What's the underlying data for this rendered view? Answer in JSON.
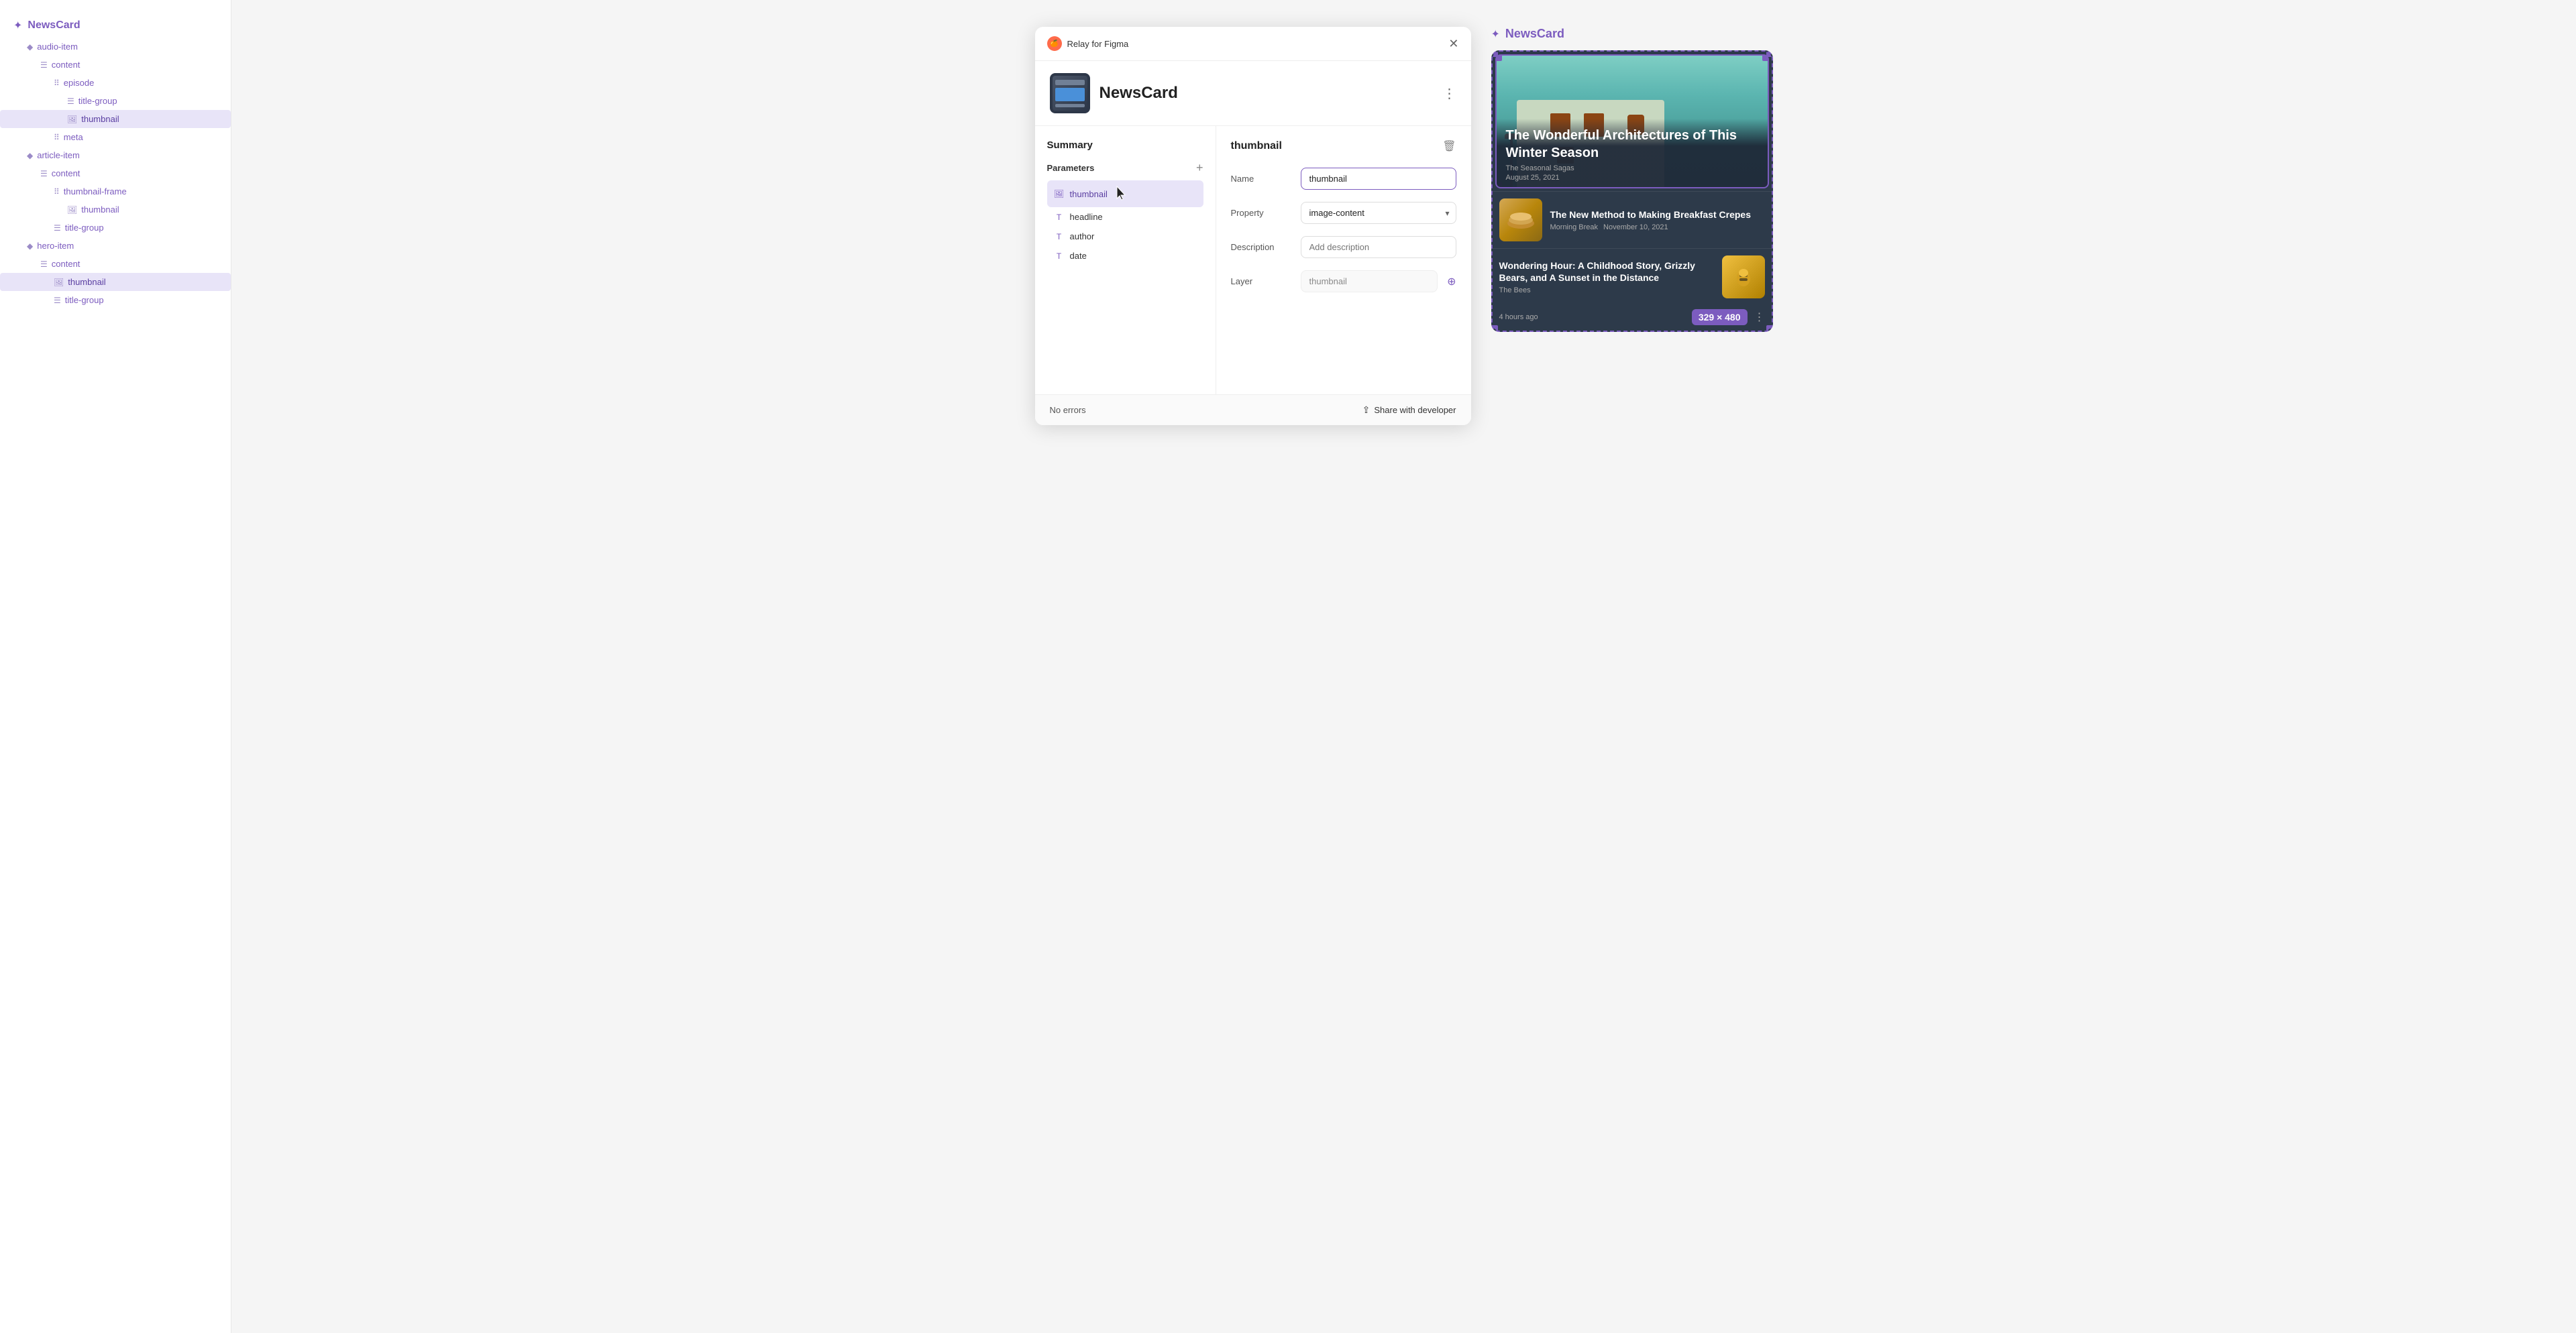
{
  "app": {
    "title": "NewsCard"
  },
  "sidebar": {
    "root_label": "NewsCard",
    "items": [
      {
        "id": "audio-item",
        "label": "audio-item",
        "icon": "diamond",
        "indent": 1,
        "selected": false
      },
      {
        "id": "content",
        "label": "content",
        "icon": "menu",
        "indent": 2,
        "selected": false
      },
      {
        "id": "episode",
        "label": "episode",
        "icon": "bars",
        "indent": 3,
        "selected": false
      },
      {
        "id": "title-group",
        "label": "title-group",
        "icon": "menu",
        "indent": 4,
        "selected": false
      },
      {
        "id": "thumbnail-1",
        "label": "thumbnail",
        "icon": "image",
        "indent": 4,
        "selected": true
      },
      {
        "id": "meta",
        "label": "meta",
        "icon": "bars",
        "indent": 3,
        "selected": false
      },
      {
        "id": "article-item",
        "label": "article-item",
        "icon": "diamond",
        "indent": 1,
        "selected": false
      },
      {
        "id": "content-2",
        "label": "content",
        "icon": "menu",
        "indent": 2,
        "selected": false
      },
      {
        "id": "thumbnail-frame",
        "label": "thumbnail-frame",
        "icon": "bars",
        "indent": 3,
        "selected": false
      },
      {
        "id": "thumbnail-2",
        "label": "thumbnail",
        "icon": "image",
        "indent": 4,
        "selected": false
      },
      {
        "id": "title-group-2",
        "label": "title-group",
        "icon": "menu",
        "indent": 3,
        "selected": false
      },
      {
        "id": "hero-item",
        "label": "hero-item",
        "icon": "diamond",
        "indent": 1,
        "selected": false
      },
      {
        "id": "content-3",
        "label": "content",
        "icon": "menu",
        "indent": 2,
        "selected": false
      },
      {
        "id": "thumbnail-3",
        "label": "thumbnail",
        "icon": "image",
        "indent": 3,
        "selected": true
      },
      {
        "id": "title-group-3",
        "label": "title-group",
        "icon": "menu",
        "indent": 3,
        "selected": false
      }
    ]
  },
  "dialog": {
    "title": "Relay for Figma",
    "component_name": "NewsCard",
    "sections": {
      "summary_label": "Summary",
      "parameters_label": "Parameters",
      "add_button": "+",
      "params": [
        {
          "id": "thumbnail",
          "label": "thumbnail",
          "icon": "image",
          "selected": true
        },
        {
          "id": "headline",
          "label": "headline",
          "icon": "text"
        },
        {
          "id": "author",
          "label": "author",
          "icon": "text"
        },
        {
          "id": "date",
          "label": "date",
          "icon": "text"
        }
      ]
    },
    "detail": {
      "title": "thumbnail",
      "fields": {
        "name_label": "Name",
        "name_value": "thumbnail",
        "property_label": "Property",
        "property_value": "image-content",
        "description_label": "Description",
        "description_placeholder": "Add description",
        "layer_label": "Layer",
        "layer_value": "thumbnail"
      }
    },
    "footer": {
      "no_errors": "No errors",
      "share_label": "Share with developer"
    }
  },
  "preview": {
    "title": "NewsCard",
    "hero": {
      "title": "The Wonderful Architectures of This Winter Season",
      "source": "The Seasonal Sagas",
      "date": "August 25, 2021"
    },
    "articles": [
      {
        "title": "The New Method to Making Breakfast Crepes",
        "source": "Morning Break",
        "date": "November 10, 2021",
        "thumb_side": "left"
      },
      {
        "title": "Wondering Hour: A Childhood Story, Grizzly Bears, and A Sunset in the Distance",
        "source": "The Bees",
        "time": "4 hours ago",
        "thumb_side": "right"
      }
    ],
    "size_badge": "329 × 480"
  }
}
